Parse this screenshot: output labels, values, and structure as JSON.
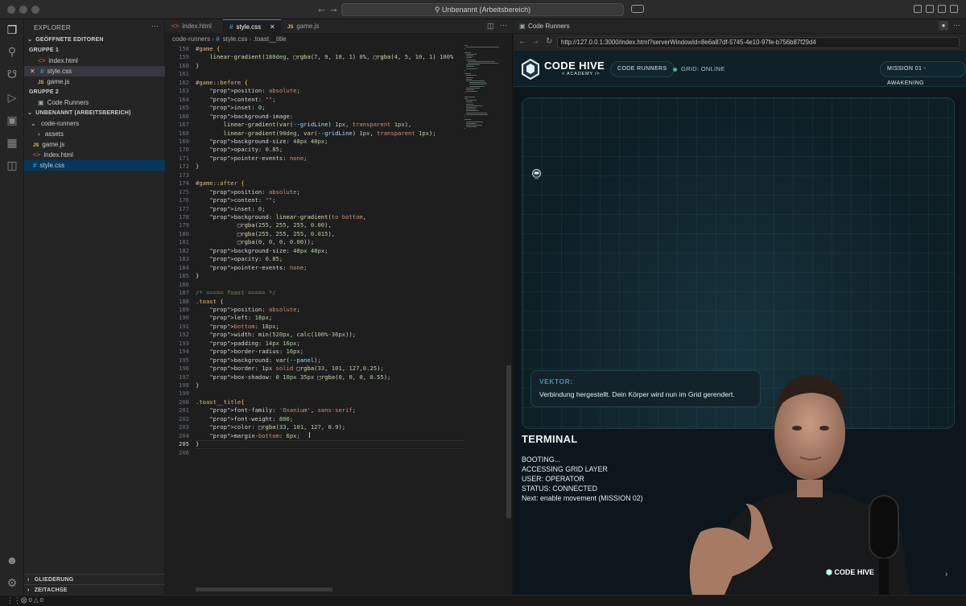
{
  "titlebar": {
    "command_center": "Unbenannt (Arbeitsbereich)"
  },
  "explorer": {
    "title": "EXPLORER",
    "open_editors_label": "GEÖFFNETE EDITOREN",
    "group1_label": "GRUPPE 1",
    "group1_files": [
      "index.html",
      "style.css",
      "game.js"
    ],
    "group2_label": "GRUPPE 2",
    "group2_files": [
      "Code Runners"
    ],
    "workspace_label": "UNBENANNT (ARBEITSBEREICH)",
    "folder": "code-runners",
    "folder_items": [
      "assets",
      "game.js",
      "index.html",
      "style.css"
    ],
    "outline_label": "GLIEDERUNG",
    "timeline_label": "ZEITACHSE"
  },
  "editor": {
    "tabs": [
      "index.html",
      "style.css",
      "game.js"
    ],
    "active_tab": "style.css",
    "breadcrumb": [
      "code-runners",
      "style.css",
      ".toast__title"
    ],
    "line_numbers": [
      "158",
      "159",
      "160",
      "161",
      "162",
      "163",
      "164",
      "165",
      "166",
      "167",
      "168",
      "169",
      "170",
      "171",
      "172",
      "173",
      "174",
      "175",
      "176",
      "177",
      "178",
      "179",
      "180",
      "181",
      "182",
      "183",
      "184",
      "185",
      "186",
      "187",
      "188",
      "189",
      "190",
      "191",
      "192",
      "193",
      "194",
      "195",
      "196",
      "197",
      "198",
      "199",
      "200",
      "201",
      "202",
      "203",
      "204",
      "205",
      "206"
    ],
    "lines": [
      "#game {",
      "    linear-gradient(180deg, □rgba(7, 9, 18, 1) 0%, □rgba(4, 5, 10, 1) 100%",
      "}",
      "",
      "#game::before {",
      "    position: absolute;",
      "    content: \"\";",
      "    inset: 0;",
      "    background-image:",
      "        linear-gradient(var(--gridLine) 1px, transparent 1px),",
      "        linear-gradient(90deg, var(--gridLine) 1px, transparent 1px);",
      "    background-size: 48px 48px;",
      "    opacity: 0.85;",
      "    pointer-events: none;",
      "}",
      "",
      "#game::after {",
      "    position: absolute;",
      "    content: \"\";",
      "    inset: 0;",
      "    background: linear-gradient(to bottom,",
      "            □rgba(255, 255, 255, 0.00),",
      "            □rgba(255, 255, 255, 0.015),",
      "            □rgba(0, 0, 0, 0.00));",
      "    background-size: 48px 48px;",
      "    opacity: 0.85;",
      "    pointer-events: none;",
      "}",
      "",
      "/* ===== Toast ===== */",
      ".toast {",
      "    position: absolute;",
      "    left: 18px;",
      "    bottom: 18px;",
      "    width: min(520px, calc(100%-36px));",
      "    padding: 14px 16px;",
      "    border-radius: 16px;",
      "    background: var(--panel);",
      "    border: 1px solid □rgba(33, 101, 127,0.25);",
      "    box-shadow: 0 10px 35px □rgba(0, 0, 0, 0.55);",
      "}",
      "",
      ".toast__title{",
      "    font-family: 'Oxanium', sans-serif;",
      "    font-weight: 800;",
      "    color: □rgba(33, 101, 127, 0.9);",
      "    margin-bottom: 6px;",
      "}",
      ""
    ]
  },
  "browser": {
    "tab_title": "Code Runners",
    "url": "http://127.0.0.1:3000/index.html?serverWindowId=8e6a87df-5745-4e10-97fe-b756b87f29d4"
  },
  "site": {
    "logo_main": "CODE HIVE",
    "logo_sub": "< ACADEMY />",
    "nav_pill": "CODE RUNNERS",
    "grid_status": "GRID: ONLINE",
    "mission_pill": "MISSION 01 - AWAKENING",
    "toast": {
      "title": "VEKTOR:",
      "text": "Verbindung hergestellt. Dein Körper wird nun im Grid gerendert."
    },
    "terminal": {
      "title": "TERMINAL",
      "lines": [
        "BOOTING...",
        "ACCESSING GRID LAYER",
        "USER: OPERATOR",
        "STATUS: CONNECTED",
        "Next: enable movement (MISSION 02)"
      ]
    }
  },
  "presenter": {
    "mic_brand": "CODE HIVE"
  },
  "statusbar": {
    "errors": "0",
    "warnings": "0"
  },
  "colors": {
    "accent": "#3794ff",
    "toast_title": "#4c8fa8",
    "grid_online": "#3fb88a"
  }
}
